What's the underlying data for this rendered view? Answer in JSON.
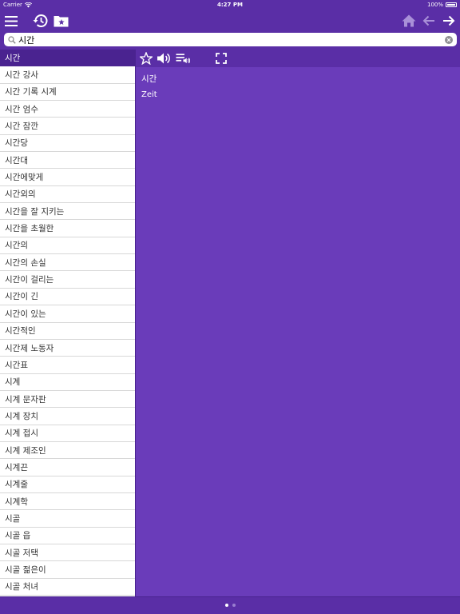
{
  "status_bar": {
    "carrier": "Carrier",
    "time": "4:27 PM",
    "battery": "100%"
  },
  "search": {
    "value": "시간",
    "placeholder": ""
  },
  "word_list": [
    "시간",
    "시간 강사",
    "시간 기록 시계",
    "시간 엄수",
    "시간 잠깐",
    "시간당",
    "시간대",
    "시간에맞게",
    "시간외의",
    "시간을 잘 지키는",
    "시간을 초월한",
    "시간의",
    "시간의 손실",
    "시간이 걸리는",
    "시간이 긴",
    "시간이 있는",
    "시간적인",
    "시간제 노동자",
    "시간표",
    "시계",
    "시계 문자판",
    "시계 장치",
    "시계 접시",
    "시계 제조인",
    "시계끈",
    "시계줄",
    "시계학",
    "시골",
    "시골 읍",
    "시골 저택",
    "시골 젊은이",
    "시골 처녀"
  ],
  "selected_index": 0,
  "detail": {
    "headword": "시간",
    "translation": "Zeit"
  },
  "icons": {
    "menu": "menu-icon",
    "history": "history-icon",
    "bookmarks": "bookmark-folder-icon",
    "home": "home-icon",
    "back": "arrow-left-icon",
    "forward": "arrow-right-icon",
    "favorite": "star-icon",
    "speak": "speaker-icon",
    "playlist": "playlist-audio-icon",
    "fullscreen": "fullscreen-icon"
  },
  "colors": {
    "header": "#5a2ea6",
    "selected": "#4a2390",
    "detail_bg": "#6a3cba"
  },
  "page_indicator": {
    "pages": 2,
    "current": 1
  }
}
